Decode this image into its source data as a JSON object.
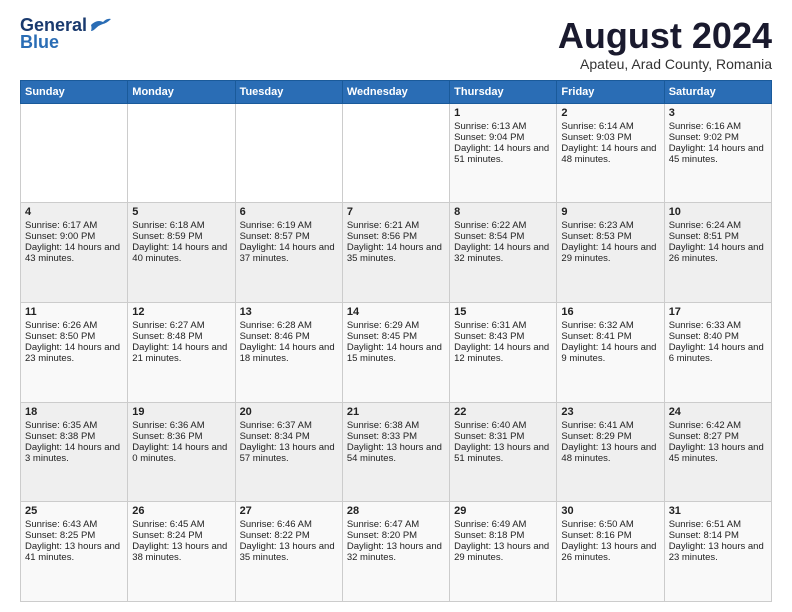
{
  "logo": {
    "line1": "General",
    "line2": "Blue"
  },
  "title": "August 2024",
  "location": "Apateu, Arad County, Romania",
  "days_header": [
    "Sunday",
    "Monday",
    "Tuesday",
    "Wednesday",
    "Thursday",
    "Friday",
    "Saturday"
  ],
  "weeks": [
    [
      {
        "day": "",
        "info": ""
      },
      {
        "day": "",
        "info": ""
      },
      {
        "day": "",
        "info": ""
      },
      {
        "day": "",
        "info": ""
      },
      {
        "day": "1",
        "info": "Sunrise: 6:13 AM\nSunset: 9:04 PM\nDaylight: 14 hours and 51 minutes."
      },
      {
        "day": "2",
        "info": "Sunrise: 6:14 AM\nSunset: 9:03 PM\nDaylight: 14 hours and 48 minutes."
      },
      {
        "day": "3",
        "info": "Sunrise: 6:16 AM\nSunset: 9:02 PM\nDaylight: 14 hours and 45 minutes."
      }
    ],
    [
      {
        "day": "4",
        "info": "Sunrise: 6:17 AM\nSunset: 9:00 PM\nDaylight: 14 hours and 43 minutes."
      },
      {
        "day": "5",
        "info": "Sunrise: 6:18 AM\nSunset: 8:59 PM\nDaylight: 14 hours and 40 minutes."
      },
      {
        "day": "6",
        "info": "Sunrise: 6:19 AM\nSunset: 8:57 PM\nDaylight: 14 hours and 37 minutes."
      },
      {
        "day": "7",
        "info": "Sunrise: 6:21 AM\nSunset: 8:56 PM\nDaylight: 14 hours and 35 minutes."
      },
      {
        "day": "8",
        "info": "Sunrise: 6:22 AM\nSunset: 8:54 PM\nDaylight: 14 hours and 32 minutes."
      },
      {
        "day": "9",
        "info": "Sunrise: 6:23 AM\nSunset: 8:53 PM\nDaylight: 14 hours and 29 minutes."
      },
      {
        "day": "10",
        "info": "Sunrise: 6:24 AM\nSunset: 8:51 PM\nDaylight: 14 hours and 26 minutes."
      }
    ],
    [
      {
        "day": "11",
        "info": "Sunrise: 6:26 AM\nSunset: 8:50 PM\nDaylight: 14 hours and 23 minutes."
      },
      {
        "day": "12",
        "info": "Sunrise: 6:27 AM\nSunset: 8:48 PM\nDaylight: 14 hours and 21 minutes."
      },
      {
        "day": "13",
        "info": "Sunrise: 6:28 AM\nSunset: 8:46 PM\nDaylight: 14 hours and 18 minutes."
      },
      {
        "day": "14",
        "info": "Sunrise: 6:29 AM\nSunset: 8:45 PM\nDaylight: 14 hours and 15 minutes."
      },
      {
        "day": "15",
        "info": "Sunrise: 6:31 AM\nSunset: 8:43 PM\nDaylight: 14 hours and 12 minutes."
      },
      {
        "day": "16",
        "info": "Sunrise: 6:32 AM\nSunset: 8:41 PM\nDaylight: 14 hours and 9 minutes."
      },
      {
        "day": "17",
        "info": "Sunrise: 6:33 AM\nSunset: 8:40 PM\nDaylight: 14 hours and 6 minutes."
      }
    ],
    [
      {
        "day": "18",
        "info": "Sunrise: 6:35 AM\nSunset: 8:38 PM\nDaylight: 14 hours and 3 minutes."
      },
      {
        "day": "19",
        "info": "Sunrise: 6:36 AM\nSunset: 8:36 PM\nDaylight: 14 hours and 0 minutes."
      },
      {
        "day": "20",
        "info": "Sunrise: 6:37 AM\nSunset: 8:34 PM\nDaylight: 13 hours and 57 minutes."
      },
      {
        "day": "21",
        "info": "Sunrise: 6:38 AM\nSunset: 8:33 PM\nDaylight: 13 hours and 54 minutes."
      },
      {
        "day": "22",
        "info": "Sunrise: 6:40 AM\nSunset: 8:31 PM\nDaylight: 13 hours and 51 minutes."
      },
      {
        "day": "23",
        "info": "Sunrise: 6:41 AM\nSunset: 8:29 PM\nDaylight: 13 hours and 48 minutes."
      },
      {
        "day": "24",
        "info": "Sunrise: 6:42 AM\nSunset: 8:27 PM\nDaylight: 13 hours and 45 minutes."
      }
    ],
    [
      {
        "day": "25",
        "info": "Sunrise: 6:43 AM\nSunset: 8:25 PM\nDaylight: 13 hours and 41 minutes."
      },
      {
        "day": "26",
        "info": "Sunrise: 6:45 AM\nSunset: 8:24 PM\nDaylight: 13 hours and 38 minutes."
      },
      {
        "day": "27",
        "info": "Sunrise: 6:46 AM\nSunset: 8:22 PM\nDaylight: 13 hours and 35 minutes."
      },
      {
        "day": "28",
        "info": "Sunrise: 6:47 AM\nSunset: 8:20 PM\nDaylight: 13 hours and 32 minutes."
      },
      {
        "day": "29",
        "info": "Sunrise: 6:49 AM\nSunset: 8:18 PM\nDaylight: 13 hours and 29 minutes."
      },
      {
        "day": "30",
        "info": "Sunrise: 6:50 AM\nSunset: 8:16 PM\nDaylight: 13 hours and 26 minutes."
      },
      {
        "day": "31",
        "info": "Sunrise: 6:51 AM\nSunset: 8:14 PM\nDaylight: 13 hours and 23 minutes."
      }
    ]
  ]
}
